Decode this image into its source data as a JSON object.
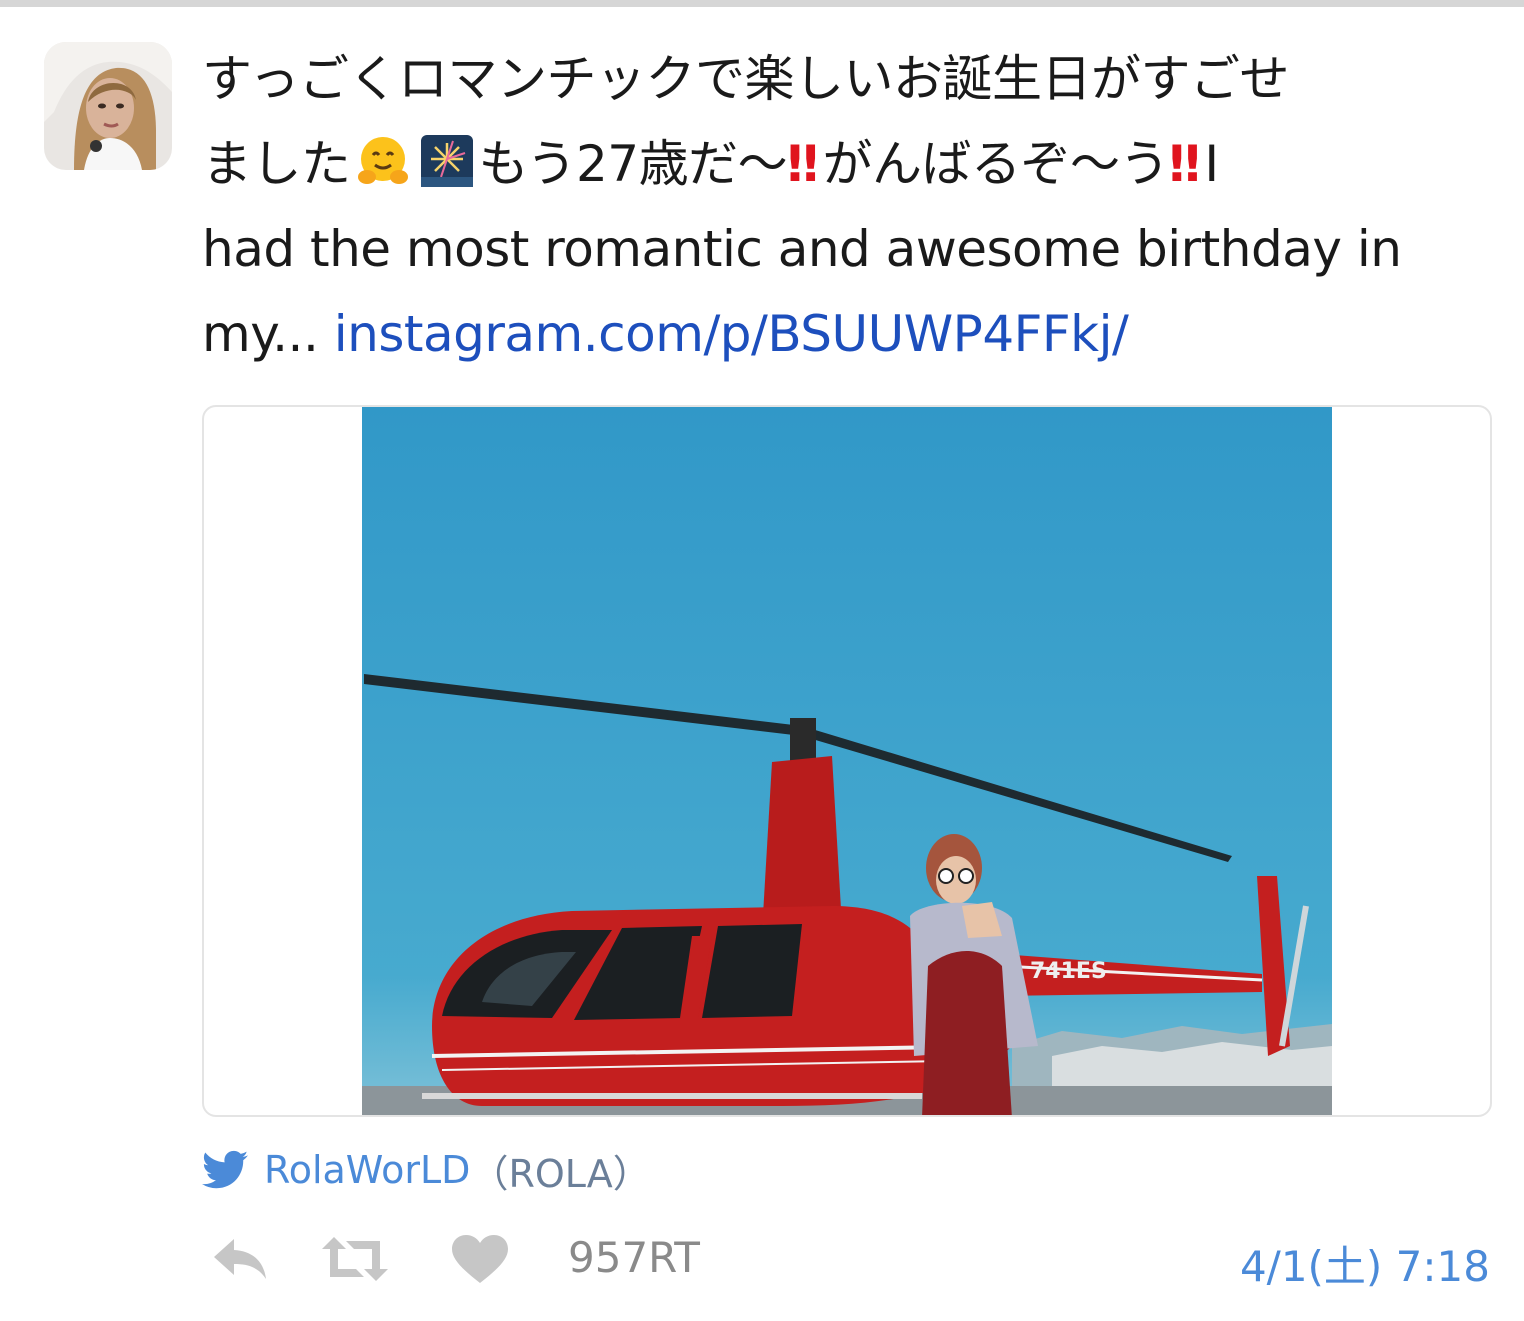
{
  "tweet": {
    "text_line1": "すっごくロマンチックで楽しいお誕生日がすごせ",
    "text_line2_a": "ました",
    "text_line2_b": "もう27歳だ〜",
    "text_line2_c": "がんばるぞ〜う",
    "text_line2_d": "I",
    "text_line3": "had the most romantic and awesome birthday in",
    "text_line4_prefix": "my... ",
    "link": "instagram.com/p/BSUUWP4FFkj/",
    "emoji_1": "hugging-face-emoji",
    "emoji_2": "fireworks-emoji",
    "bang": "‼",
    "media_text": "741ES"
  },
  "source": {
    "handle": "RolaWorLD",
    "name": "（ROLA）"
  },
  "actions": {
    "retweet_count": "957RT",
    "timestamp": "4/1(土) 7:18"
  },
  "colors": {
    "link": "#1d4fbd",
    "accent": "#4b8ad8",
    "bang": "#e0141e",
    "sky": "#3aa0cc",
    "helicopter": "#c41f1f"
  }
}
